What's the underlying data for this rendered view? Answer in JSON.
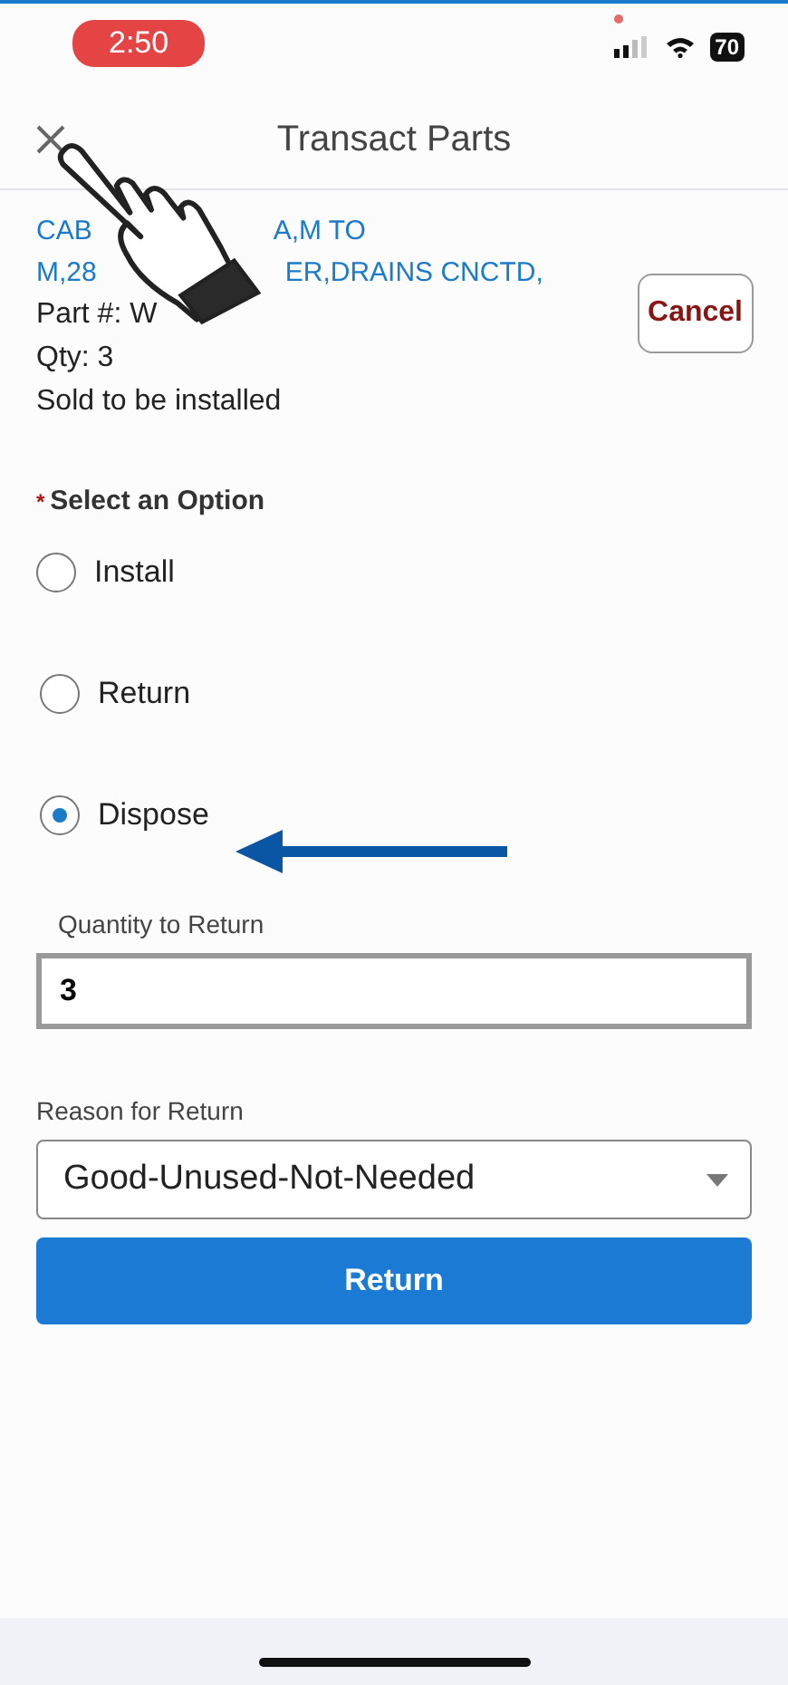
{
  "status_bar": {
    "time": "2:50",
    "battery": "70"
  },
  "header": {
    "title": "Transact Parts"
  },
  "part": {
    "description_lines": [
      [
        "CAB",
        "A,M TO"
      ],
      [
        "M,28",
        "ER,DRAINS CNCTD,"
      ]
    ],
    "part_number": "Part #: W",
    "qty": "Qty: 3",
    "status": "Sold to be installed"
  },
  "cancel_button": "Cancel",
  "option_group": {
    "required_mark": "*",
    "label": "Select an Option",
    "options": [
      {
        "label": "Install",
        "selected": false
      },
      {
        "label": "Return",
        "selected": false
      },
      {
        "label": "Dispose",
        "selected": true
      }
    ]
  },
  "quantity": {
    "label": "Quantity to Return",
    "value": "3"
  },
  "reason": {
    "label": "Reason for Return",
    "value": "Good-Unused-Not-Needed"
  },
  "return_button": "Return"
}
